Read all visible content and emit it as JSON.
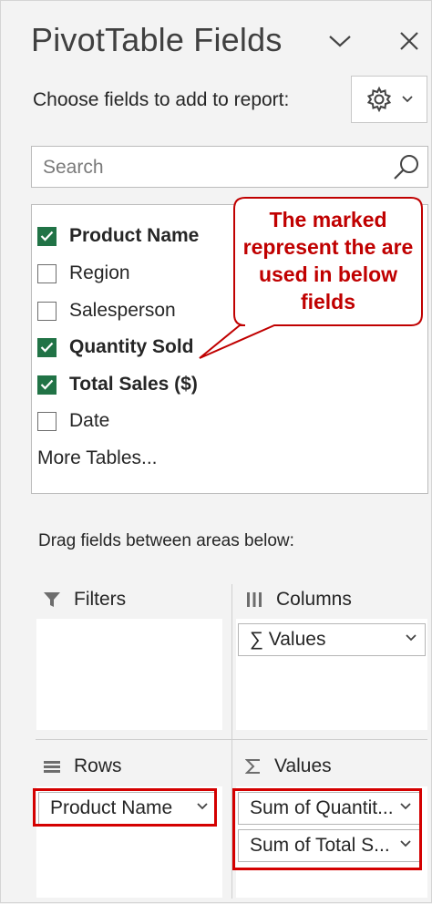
{
  "pane": {
    "title": "PivotTable Fields",
    "choose_label": "Choose fields to add to report:"
  },
  "search": {
    "placeholder": "Search"
  },
  "fields": [
    {
      "label": "Product Name",
      "checked": true
    },
    {
      "label": "Region",
      "checked": false
    },
    {
      "label": "Salesperson",
      "checked": false
    },
    {
      "label": "Quantity Sold",
      "checked": true
    },
    {
      "label": "Total Sales ($)",
      "checked": true
    },
    {
      "label": "Date",
      "checked": false
    }
  ],
  "more_tables": "More Tables...",
  "callout": {
    "text": "The marked represent the are used in below fields"
  },
  "drag_label": "Drag fields between areas below:",
  "areas": {
    "filters": {
      "label": "Filters"
    },
    "columns": {
      "label": "Columns",
      "pill": "∑ Values"
    },
    "rows": {
      "label": "Rows",
      "pill": "Product Name"
    },
    "values": {
      "label": "Values",
      "pills": [
        "Sum of Quantit...",
        "Sum of Total S..."
      ]
    }
  },
  "colors": {
    "check": "#217346",
    "annotation": "#c00000",
    "highlight": "#d40000"
  }
}
